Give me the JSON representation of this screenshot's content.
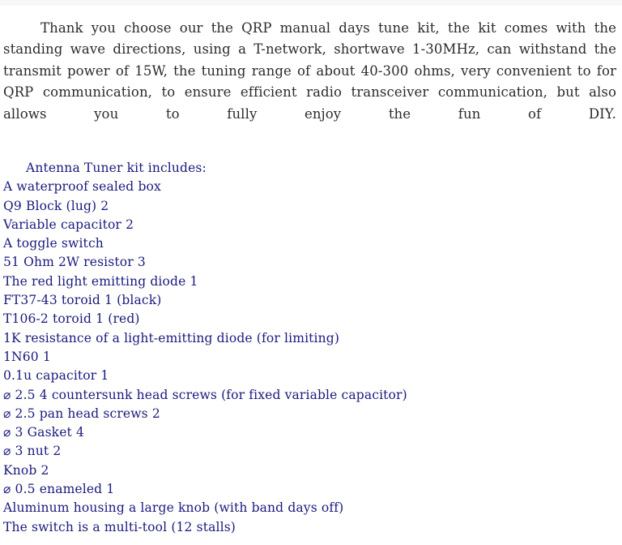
{
  "document": {
    "intro_paragraph": "Thank you choose our the QRP manual days tune kit, the kit comes with the standing wave directions, using a T-network, shortwave 1-30MHz, can withstand the transmit power of 15W, the tuning range of about 40-300 ohms, very convenient to for QRP communication, to ensure efficient radio transceiver communication, but also allows you to fully enjoy the fun of DIY.",
    "kit_heading": "Antenna Tuner kit includes:",
    "kit_items": [
      "A waterproof sealed box",
      "Q9 Block (lug) 2",
      "Variable capacitor 2",
      "A toggle switch",
      "51 Ohm 2W resistor 3",
      "The red light emitting diode 1",
      "FT37-43 toroid 1 (black)",
      "T106-2 toroid 1 (red)",
      "1K resistance of a light-emitting diode (for limiting)",
      "1N60 1",
      "0.1u capacitor 1",
      "⌀ 2.5 4 countersunk head screws (for fixed variable capacitor)",
      "⌀ 2.5 pan head screws 2",
      "⌀ 3 Gasket 4",
      "⌀ 3 nut 2",
      "Knob 2",
      "⌀ 0.5 enameled 1",
      "Aluminum housing a large knob (with band days off)",
      "The switch is a multi-tool (12 stalls)"
    ],
    "colors": {
      "background": "#ffffff",
      "intro_text": "#2b2b2b",
      "list_text": "#1a1a7e",
      "top_band": "#f7f7f8"
    }
  }
}
